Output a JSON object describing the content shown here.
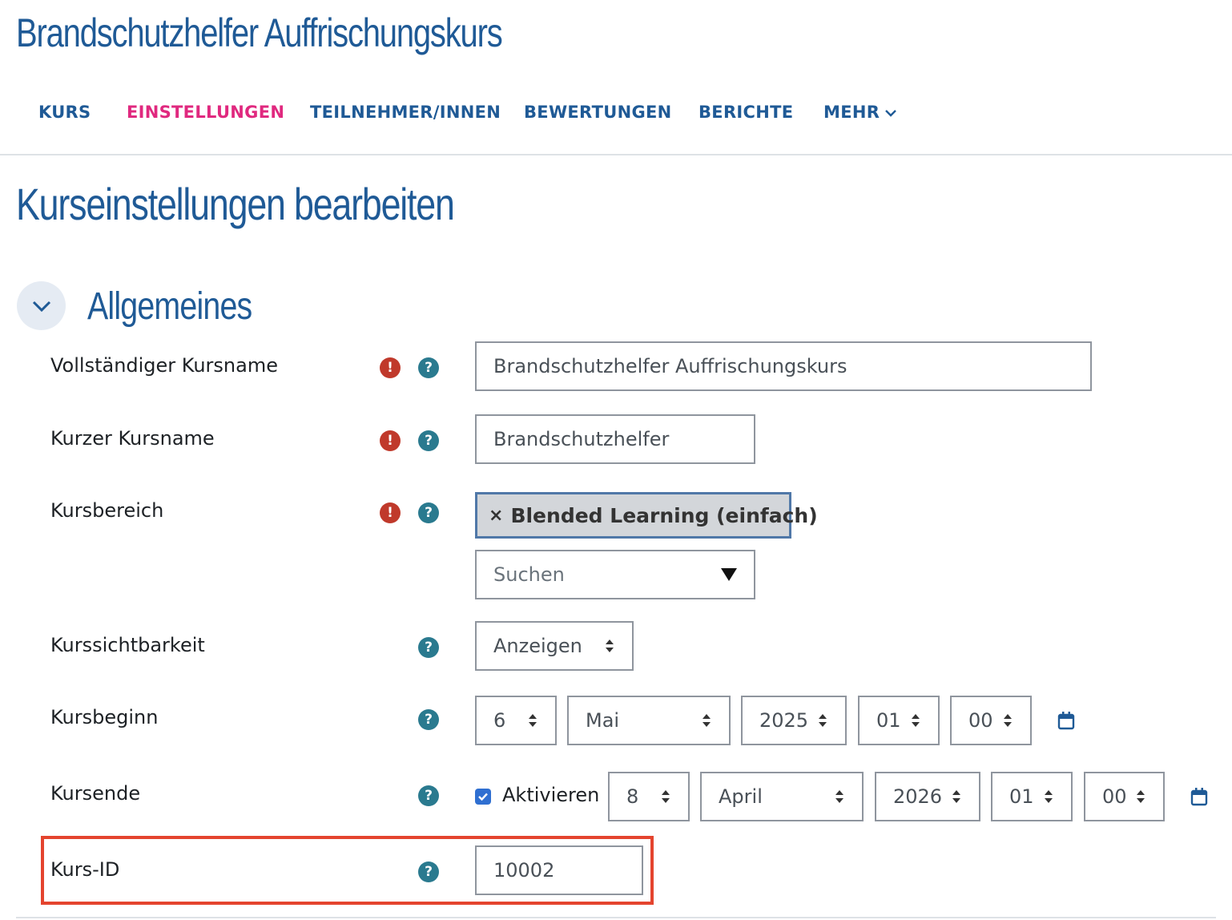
{
  "course_title": "Brandschutzhelfer Auffrischungskurs",
  "nav": {
    "items": [
      "KURS",
      "EINSTELLUNGEN",
      "TEILNEHMER/INNEN",
      "BEWERTUNGEN",
      "BERICHTE",
      "MEHR"
    ],
    "active": "EINSTELLUNGEN"
  },
  "page_heading": "Kurseinstellungen bearbeiten",
  "section": {
    "title": "Allgemeines",
    "expanded": true
  },
  "form": {
    "fullname": {
      "label": "Vollständiger Kursname",
      "value": "Brandschutzhelfer Auffrischungskurs"
    },
    "shortname": {
      "label": "Kurzer Kursname",
      "value": "Brandschutzhelfer"
    },
    "category": {
      "label": "Kursbereich",
      "tag_remove": "×",
      "selected": "Blended Learning (einfach)",
      "search_placeholder": "Suchen"
    },
    "visibility": {
      "label": "Kurssichtbarkeit",
      "value": "Anzeigen"
    },
    "startdate": {
      "label": "Kursbeginn",
      "day": "6",
      "month": "Mai",
      "year": "2025",
      "hour": "01",
      "minute": "00"
    },
    "enddate": {
      "label": "Kursende",
      "enable_label": "Aktivieren",
      "enabled": true,
      "day": "8",
      "month": "April",
      "year": "2026",
      "hour": "01",
      "minute": "00"
    },
    "idnumber": {
      "label": "Kurs-ID",
      "value": "10002"
    }
  },
  "icons": {
    "required": "!",
    "help": "?"
  },
  "colors": {
    "brand": "#1f5a96",
    "active_nav": "#e0297f",
    "required": "#c0392b",
    "help": "#2a7a8f",
    "highlight": "#e4442e",
    "checkbox": "#2f6fd1"
  }
}
